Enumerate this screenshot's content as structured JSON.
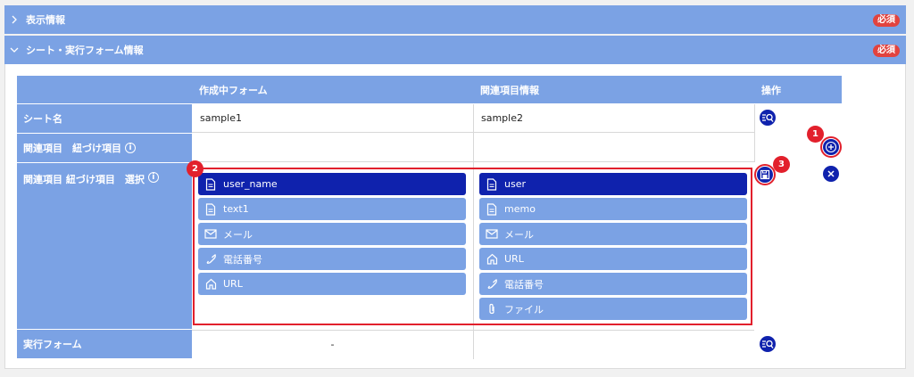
{
  "sections": [
    {
      "title": "表示情報",
      "required": "必須",
      "expanded": false
    },
    {
      "title": "シート・実行フォーム情報",
      "required": "必須",
      "expanded": true
    }
  ],
  "table": {
    "headers": [
      "作成中フォーム",
      "関連項目情報",
      "操作"
    ],
    "rows": {
      "sheet": {
        "label": "シート名",
        "form_value": "sample1",
        "related_value": "sample2"
      },
      "link_items": {
        "label": "関連項目　紐づけ項目"
      },
      "link_select": {
        "label": "関連項目 紐づけ項目　選択"
      },
      "exec_form": {
        "label": "実行フォーム",
        "form_value": "-"
      }
    },
    "left_items": [
      {
        "label": "user_name",
        "icon": "document-icon",
        "selected": true
      },
      {
        "label": "text1",
        "icon": "document-icon",
        "selected": false
      },
      {
        "label": "メール",
        "icon": "mail-icon",
        "selected": false
      },
      {
        "label": "電話番号",
        "icon": "phone-icon",
        "selected": false
      },
      {
        "label": "URL",
        "icon": "home-icon",
        "selected": false
      }
    ],
    "right_items": [
      {
        "label": "user",
        "icon": "document-icon",
        "selected": true
      },
      {
        "label": "memo",
        "icon": "document-icon",
        "selected": false
      },
      {
        "label": "メール",
        "icon": "mail-icon",
        "selected": false
      },
      {
        "label": "URL",
        "icon": "home-icon",
        "selected": false
      },
      {
        "label": "電話番号",
        "icon": "phone-icon",
        "selected": false
      },
      {
        "label": "ファイル",
        "icon": "paperclip-icon",
        "selected": false
      }
    ]
  },
  "annotations": [
    "1",
    "2",
    "3"
  ],
  "colors": {
    "header_blue": "#7ba2e4",
    "selected_navy": "#0f22ad",
    "required_red": "#e2433e",
    "annotation_red": "#e2202c"
  }
}
